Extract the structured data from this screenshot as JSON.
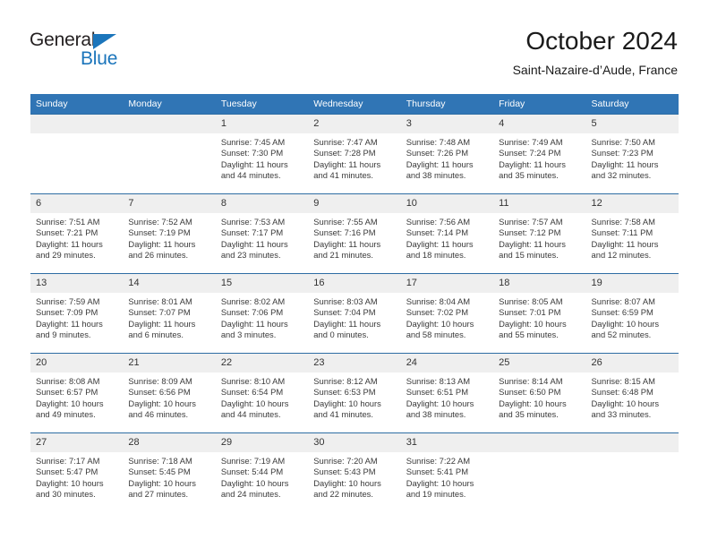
{
  "brand": {
    "name_top": "General",
    "name_bottom": "Blue",
    "accent_color": "#1b75bb"
  },
  "header": {
    "title": "October 2024",
    "subtitle": "Saint-Nazaire-d’Aude, France"
  },
  "theme": {
    "header_row_bg": "#3075b5",
    "daynum_bg": "#efefef",
    "row_divider": "#2e6da4",
    "text": "#3a3a3a"
  },
  "weekday_headers": [
    "Sunday",
    "Monday",
    "Tuesday",
    "Wednesday",
    "Thursday",
    "Friday",
    "Saturday"
  ],
  "weeks": [
    [
      {
        "day": "",
        "sunrise": "",
        "sunset": "",
        "daylight_line1": "",
        "daylight_line2": ""
      },
      {
        "day": "",
        "sunrise": "",
        "sunset": "",
        "daylight_line1": "",
        "daylight_line2": ""
      },
      {
        "day": "1",
        "sunrise": "Sunrise: 7:45 AM",
        "sunset": "Sunset: 7:30 PM",
        "daylight_line1": "Daylight: 11 hours",
        "daylight_line2": "and 44 minutes."
      },
      {
        "day": "2",
        "sunrise": "Sunrise: 7:47 AM",
        "sunset": "Sunset: 7:28 PM",
        "daylight_line1": "Daylight: 11 hours",
        "daylight_line2": "and 41 minutes."
      },
      {
        "day": "3",
        "sunrise": "Sunrise: 7:48 AM",
        "sunset": "Sunset: 7:26 PM",
        "daylight_line1": "Daylight: 11 hours",
        "daylight_line2": "and 38 minutes."
      },
      {
        "day": "4",
        "sunrise": "Sunrise: 7:49 AM",
        "sunset": "Sunset: 7:24 PM",
        "daylight_line1": "Daylight: 11 hours",
        "daylight_line2": "and 35 minutes."
      },
      {
        "day": "5",
        "sunrise": "Sunrise: 7:50 AM",
        "sunset": "Sunset: 7:23 PM",
        "daylight_line1": "Daylight: 11 hours",
        "daylight_line2": "and 32 minutes."
      }
    ],
    [
      {
        "day": "6",
        "sunrise": "Sunrise: 7:51 AM",
        "sunset": "Sunset: 7:21 PM",
        "daylight_line1": "Daylight: 11 hours",
        "daylight_line2": "and 29 minutes."
      },
      {
        "day": "7",
        "sunrise": "Sunrise: 7:52 AM",
        "sunset": "Sunset: 7:19 PM",
        "daylight_line1": "Daylight: 11 hours",
        "daylight_line2": "and 26 minutes."
      },
      {
        "day": "8",
        "sunrise": "Sunrise: 7:53 AM",
        "sunset": "Sunset: 7:17 PM",
        "daylight_line1": "Daylight: 11 hours",
        "daylight_line2": "and 23 minutes."
      },
      {
        "day": "9",
        "sunrise": "Sunrise: 7:55 AM",
        "sunset": "Sunset: 7:16 PM",
        "daylight_line1": "Daylight: 11 hours",
        "daylight_line2": "and 21 minutes."
      },
      {
        "day": "10",
        "sunrise": "Sunrise: 7:56 AM",
        "sunset": "Sunset: 7:14 PM",
        "daylight_line1": "Daylight: 11 hours",
        "daylight_line2": "and 18 minutes."
      },
      {
        "day": "11",
        "sunrise": "Sunrise: 7:57 AM",
        "sunset": "Sunset: 7:12 PM",
        "daylight_line1": "Daylight: 11 hours",
        "daylight_line2": "and 15 minutes."
      },
      {
        "day": "12",
        "sunrise": "Sunrise: 7:58 AM",
        "sunset": "Sunset: 7:11 PM",
        "daylight_line1": "Daylight: 11 hours",
        "daylight_line2": "and 12 minutes."
      }
    ],
    [
      {
        "day": "13",
        "sunrise": "Sunrise: 7:59 AM",
        "sunset": "Sunset: 7:09 PM",
        "daylight_line1": "Daylight: 11 hours",
        "daylight_line2": "and 9 minutes."
      },
      {
        "day": "14",
        "sunrise": "Sunrise: 8:01 AM",
        "sunset": "Sunset: 7:07 PM",
        "daylight_line1": "Daylight: 11 hours",
        "daylight_line2": "and 6 minutes."
      },
      {
        "day": "15",
        "sunrise": "Sunrise: 8:02 AM",
        "sunset": "Sunset: 7:06 PM",
        "daylight_line1": "Daylight: 11 hours",
        "daylight_line2": "and 3 minutes."
      },
      {
        "day": "16",
        "sunrise": "Sunrise: 8:03 AM",
        "sunset": "Sunset: 7:04 PM",
        "daylight_line1": "Daylight: 11 hours",
        "daylight_line2": "and 0 minutes."
      },
      {
        "day": "17",
        "sunrise": "Sunrise: 8:04 AM",
        "sunset": "Sunset: 7:02 PM",
        "daylight_line1": "Daylight: 10 hours",
        "daylight_line2": "and 58 minutes."
      },
      {
        "day": "18",
        "sunrise": "Sunrise: 8:05 AM",
        "sunset": "Sunset: 7:01 PM",
        "daylight_line1": "Daylight: 10 hours",
        "daylight_line2": "and 55 minutes."
      },
      {
        "day": "19",
        "sunrise": "Sunrise: 8:07 AM",
        "sunset": "Sunset: 6:59 PM",
        "daylight_line1": "Daylight: 10 hours",
        "daylight_line2": "and 52 minutes."
      }
    ],
    [
      {
        "day": "20",
        "sunrise": "Sunrise: 8:08 AM",
        "sunset": "Sunset: 6:57 PM",
        "daylight_line1": "Daylight: 10 hours",
        "daylight_line2": "and 49 minutes."
      },
      {
        "day": "21",
        "sunrise": "Sunrise: 8:09 AM",
        "sunset": "Sunset: 6:56 PM",
        "daylight_line1": "Daylight: 10 hours",
        "daylight_line2": "and 46 minutes."
      },
      {
        "day": "22",
        "sunrise": "Sunrise: 8:10 AM",
        "sunset": "Sunset: 6:54 PM",
        "daylight_line1": "Daylight: 10 hours",
        "daylight_line2": "and 44 minutes."
      },
      {
        "day": "23",
        "sunrise": "Sunrise: 8:12 AM",
        "sunset": "Sunset: 6:53 PM",
        "daylight_line1": "Daylight: 10 hours",
        "daylight_line2": "and 41 minutes."
      },
      {
        "day": "24",
        "sunrise": "Sunrise: 8:13 AM",
        "sunset": "Sunset: 6:51 PM",
        "daylight_line1": "Daylight: 10 hours",
        "daylight_line2": "and 38 minutes."
      },
      {
        "day": "25",
        "sunrise": "Sunrise: 8:14 AM",
        "sunset": "Sunset: 6:50 PM",
        "daylight_line1": "Daylight: 10 hours",
        "daylight_line2": "and 35 minutes."
      },
      {
        "day": "26",
        "sunrise": "Sunrise: 8:15 AM",
        "sunset": "Sunset: 6:48 PM",
        "daylight_line1": "Daylight: 10 hours",
        "daylight_line2": "and 33 minutes."
      }
    ],
    [
      {
        "day": "27",
        "sunrise": "Sunrise: 7:17 AM",
        "sunset": "Sunset: 5:47 PM",
        "daylight_line1": "Daylight: 10 hours",
        "daylight_line2": "and 30 minutes."
      },
      {
        "day": "28",
        "sunrise": "Sunrise: 7:18 AM",
        "sunset": "Sunset: 5:45 PM",
        "daylight_line1": "Daylight: 10 hours",
        "daylight_line2": "and 27 minutes."
      },
      {
        "day": "29",
        "sunrise": "Sunrise: 7:19 AM",
        "sunset": "Sunset: 5:44 PM",
        "daylight_line1": "Daylight: 10 hours",
        "daylight_line2": "and 24 minutes."
      },
      {
        "day": "30",
        "sunrise": "Sunrise: 7:20 AM",
        "sunset": "Sunset: 5:43 PM",
        "daylight_line1": "Daylight: 10 hours",
        "daylight_line2": "and 22 minutes."
      },
      {
        "day": "31",
        "sunrise": "Sunrise: 7:22 AM",
        "sunset": "Sunset: 5:41 PM",
        "daylight_line1": "Daylight: 10 hours",
        "daylight_line2": "and 19 minutes."
      },
      {
        "day": "",
        "sunrise": "",
        "sunset": "",
        "daylight_line1": "",
        "daylight_line2": ""
      },
      {
        "day": "",
        "sunrise": "",
        "sunset": "",
        "daylight_line1": "",
        "daylight_line2": ""
      }
    ]
  ]
}
